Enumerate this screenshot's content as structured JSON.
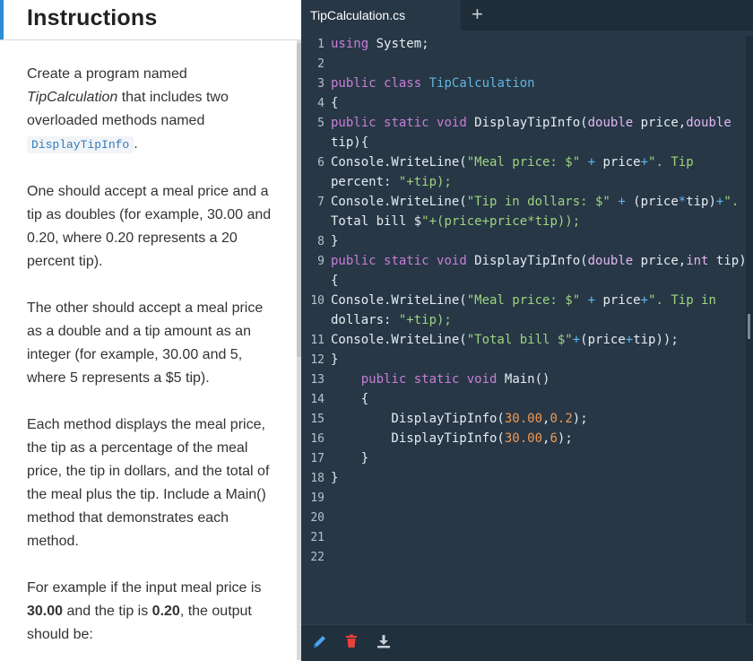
{
  "instructions": {
    "title": "Instructions",
    "p1_a": "Create a program named ",
    "p1_em": "TipCalculation",
    "p1_b": " that includes two overloaded methods named ",
    "p1_code": "DisplayTipInfo",
    "p1_c": ".",
    "p2": "One should accept a meal price and a tip as doubles (for example, 30.00 and 0.20, where 0.20 represents a 20 percent tip).",
    "p3": "The other should accept a meal price as a double and a tip amount as an integer (for example, 30.00 and 5, where 5 represents a $5 tip).",
    "p4": "Each method displays the meal price, the tip as a percentage of the meal price, the tip in dollars, and the total of the meal plus the tip. Include a Main() method that demonstrates each method.",
    "p5_a": "For example if the input meal price is ",
    "p5_b1": "30.00",
    "p5_c": " and the tip is ",
    "p5_b2": "0.20",
    "p5_d": ", the output should be:"
  },
  "editor": {
    "tab_label": "TipCalculation.cs",
    "add_tab": "+",
    "line_numbers": [
      "1",
      "2",
      "3",
      "4",
      "5",
      "6",
      "7",
      "8",
      "9",
      "10",
      "11",
      "12",
      "13",
      "14",
      "15",
      "16",
      "17",
      "18",
      "19",
      "20",
      "21",
      "22"
    ],
    "lines": [
      "using System;",
      "",
      "public class TipCalculation",
      "{",
      "public static void DisplayTipInfo(double price,double",
      "tip){",
      "Console.WriteLine(\"Meal price: $\" + price+\". Tip",
      "percent: \"+tip);",
      "Console.WriteLine(\"Tip in dollars: $\" + (price*tip)+\".",
      "Total bill $\"+(price+price*tip));",
      "}",
      "public static void DisplayTipInfo(double price,int tip)",
      "{",
      "Console.WriteLine(\"Meal price: $\" + price+\". Tip in",
      "dollars: \"+tip);",
      "Console.WriteLine(\"Total bill $\"+(price+tip));",
      "}",
      "    public static void Main()",
      "    {",
      "        DisplayTipInfo(30.00,0.2);",
      "        DisplayTipInfo(30.00,6);",
      "    }",
      "}"
    ]
  },
  "toolbar": {
    "icons": [
      "pencil-icon",
      "trash-icon",
      "download-icon"
    ],
    "colors": {
      "pencil": "#4aa3f0",
      "trash": "#e8413c",
      "download": "#c8d0d8"
    }
  }
}
